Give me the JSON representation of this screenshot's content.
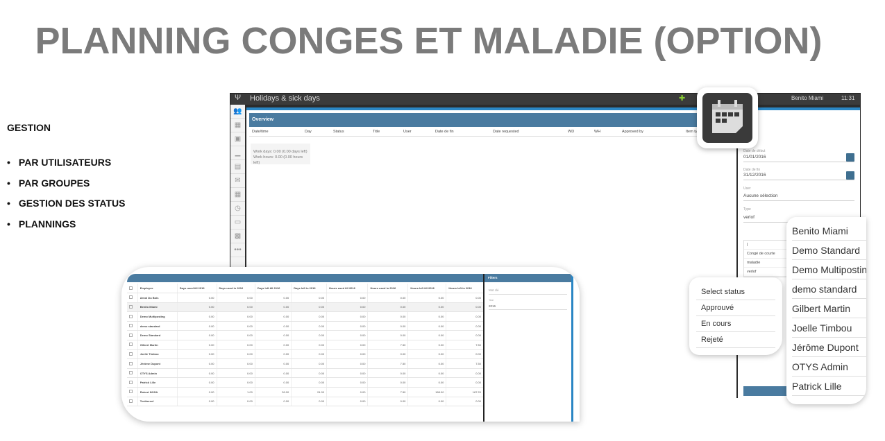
{
  "slide": {
    "title": "PLANNING CONGES ET MALADIE (OPTION)",
    "section": "GESTION",
    "bullets": [
      "PAR UTILISATEURS",
      "PAR GROUPES",
      "GESTION DES STATUS",
      "PLANNINGS"
    ]
  },
  "app": {
    "title": "Holidays & sick days",
    "user": "Benito Miami",
    "time": "11:31",
    "overview": {
      "title": "Overview",
      "columns": [
        "Date/time",
        "Day",
        "Status",
        "Title",
        "User",
        "Date de fin",
        "Date requested",
        "WD",
        "WH",
        "Approved by",
        "Item ty"
      ],
      "summary": [
        "Work days: 0.00 (0.00 days left)",
        "Work hours: 0.00 (0.00 hours left)"
      ]
    },
    "filters": {
      "date_debut_label": "Date de début",
      "date_debut": "01/01/2016",
      "date_fin_label": "Date de fin",
      "date_fin": "31/12/2016",
      "user_label": "User",
      "user_value": "Aucune sélection",
      "type_label": "Type",
      "type_value": "verlof",
      "type_options": [
        "|",
        "Congé de courte",
        "maladie",
        "verlof"
      ]
    }
  },
  "overview_table": {
    "columns": [
      "Employee",
      "Days used till 2016",
      "Days used in 2016",
      "Days left till 2016",
      "Days left in 2016",
      "Hours used till 2016",
      "Hours used in 2016",
      "Hours left till 2016",
      "Hours left in 2016"
    ],
    "rows": [
      [
        "Arnol Du Bois",
        "0.00",
        "0.00",
        "0.00",
        "0.00",
        "0.00",
        "0.00",
        "0.00",
        "0.00"
      ],
      [
        "Benito Miami",
        "0.00",
        "0.00",
        "0.00",
        "0.00",
        "0.00",
        "0.00",
        "0.00",
        "0.00"
      ],
      [
        "Demo Multiposting",
        "0.00",
        "0.00",
        "0.00",
        "0.00",
        "0.00",
        "0.00",
        "0.00",
        "0.00"
      ],
      [
        "demo standard",
        "0.00",
        "0.00",
        "0.00",
        "0.00",
        "0.00",
        "0.00",
        "0.00",
        "0.00"
      ],
      [
        "Demo Standard",
        "0.00",
        "0.00",
        "0.00",
        "0.00",
        "0.00",
        "0.00",
        "0.00",
        "0.00"
      ],
      [
        "Gilbert Martin",
        "0.00",
        "0.00",
        "0.00",
        "0.00",
        "0.00",
        "7.50",
        "0.00",
        "7.50"
      ],
      [
        "Joelle Timbou",
        "0.00",
        "0.00",
        "0.00",
        "0.00",
        "0.00",
        "0.00",
        "0.00",
        "0.00"
      ],
      [
        "Jérôme Dupont",
        "0.00",
        "0.00",
        "0.00",
        "0.00",
        "0.00",
        "7.50",
        "0.00",
        "7.50"
      ],
      [
        "OTYS Admin",
        "0.00",
        "0.00",
        "0.00",
        "0.00",
        "0.00",
        "0.00",
        "0.00",
        "0.00"
      ],
      [
        "Patrick Lille",
        "0.00",
        "0.00",
        "0.00",
        "0.00",
        "0.00",
        "0.00",
        "0.00",
        "0.00"
      ],
      [
        "Robert NOSA",
        "0.00",
        "1.00",
        "28.00",
        "24.00",
        "0.00",
        "7.50",
        "188.00",
        "187.20"
      ],
      [
        "Testkernel",
        "0.00",
        "0.00",
        "0.00",
        "0.00",
        "0.00",
        "0.00",
        "0.00",
        "0.00"
      ]
    ],
    "filters_title": "Filters",
    "filter_placeholder": "Mot clé",
    "year_label": "Year",
    "year_value": "2016"
  },
  "status_options": [
    "Select status",
    "Approuvé",
    "En cours",
    "Rejeté"
  ],
  "user_options": [
    "Benito Miami",
    "Demo Standard",
    "Demo Multipostin",
    "demo standard",
    "Gilbert Martin",
    "Joelle Timbou",
    "Jérôme Dupont",
    "OTYS Admin",
    "Patrick Lille"
  ],
  "colors": {
    "title": "#7b7b7b",
    "header_bar": "#4a7ba0",
    "accent": "#2a86c4"
  }
}
